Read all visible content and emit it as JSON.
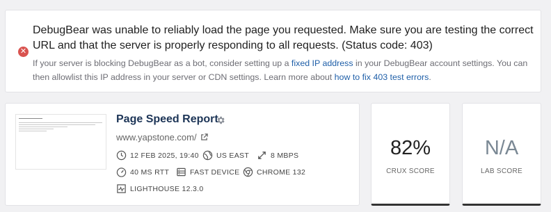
{
  "error": {
    "title": "DebugBear was unable to reliably load the page you requested. Make sure you are testing the correct URL and that the server is properly responding to all requests. (Status code: 403)",
    "detail_part1": "If your server is blocking DebugBear as a bot, consider setting up a ",
    "detail_link1": "fixed IP address",
    "detail_part2": " in your DebugBear account settings. You can then allowlist this IP address in your server or CDN settings. Learn more about ",
    "detail_link2": "how to fix 403 test errors",
    "detail_part3": ".",
    "icon": "error-x-icon",
    "color": "#d9534f"
  },
  "report": {
    "title": "Page Speed Report",
    "url": "www.yapstone.com/",
    "meta": {
      "date": "12 FEB 2025, 19:40",
      "region": "US EAST",
      "bandwidth": "8 MBPS",
      "rtt": "40 MS RTT",
      "device": "FAST DEVICE",
      "browser": "CHROME 132",
      "lighthouse": "LIGHTHOUSE 12.3.0"
    }
  },
  "scores": {
    "crux": {
      "value": "82%",
      "label": "CRUX SCORE"
    },
    "lab": {
      "value": "N/A",
      "label": "LAB SCORE"
    }
  }
}
